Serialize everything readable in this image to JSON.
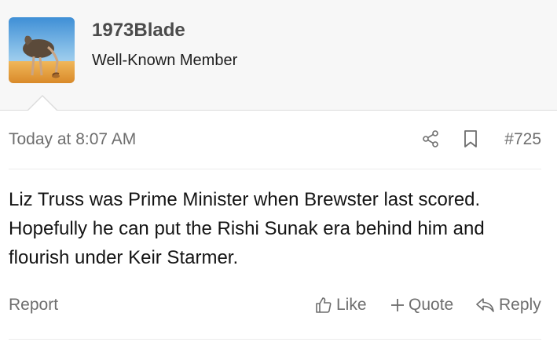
{
  "user": {
    "name": "1973Blade",
    "title": "Well-Known Member",
    "avatar_icon": "ostrich-avatar"
  },
  "post": {
    "timestamp": "Today at 8:07 AM",
    "number": "#725",
    "body": "Liz Truss was Prime Minister when Brewster last scored. Hopefully he can put the Rishi Sunak era behind him and flourish under Keir Starmer."
  },
  "actions": {
    "report": "Report",
    "like": "Like",
    "quote": "Quote",
    "reply": "Reply"
  },
  "icons": {
    "share": "share-icon",
    "bookmark": "bookmark-icon",
    "like": "thumbs-up-icon",
    "quote": "plus-icon",
    "reply": "reply-arrow-icon"
  },
  "colors": {
    "header_bg": "#f7f7f7",
    "muted_text": "#6e6e6e",
    "body_text": "#141414"
  }
}
